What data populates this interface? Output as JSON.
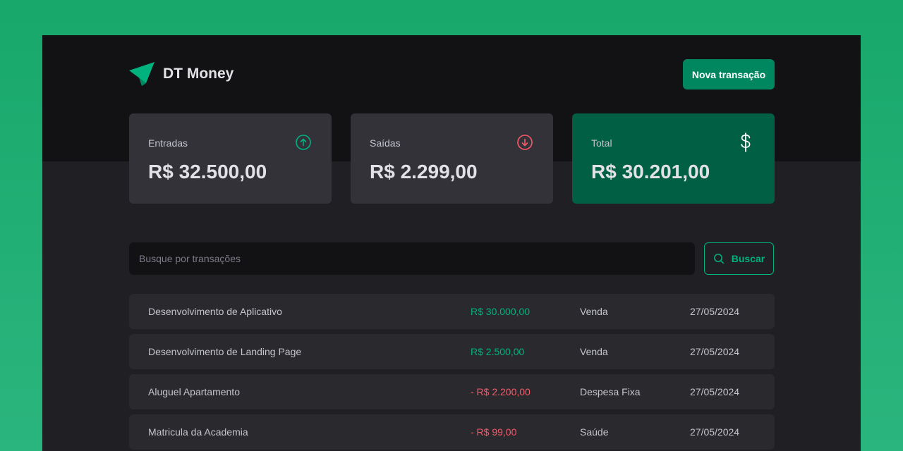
{
  "header": {
    "app_name": "DT Money",
    "new_transaction_label": "Nova transação"
  },
  "summary": {
    "income": {
      "label": "Entradas",
      "value": "R$ 32.500,00",
      "icon": "arrow-circle-up-icon"
    },
    "outcome": {
      "label": "Saídas",
      "value": "R$ 2.299,00",
      "icon": "arrow-circle-down-icon"
    },
    "total": {
      "label": "Total",
      "value": "R$ 30.201,00",
      "icon": "currency-dollar-icon"
    }
  },
  "search": {
    "placeholder": "Busque por transações",
    "value": "",
    "button_label": "Buscar"
  },
  "transactions": [
    {
      "description": "Desenvolvimento de Aplicativo",
      "price": "R$ 30.000,00",
      "type": "income",
      "category": "Venda",
      "date": "27/05/2024"
    },
    {
      "description": "Desenvolvimento de Landing Page",
      "price": "R$ 2.500,00",
      "type": "income",
      "category": "Venda",
      "date": "27/05/2024"
    },
    {
      "description": "Aluguel Apartamento",
      "price": "- R$ 2.200,00",
      "type": "outcome",
      "category": "Despesa Fixa",
      "date": "27/05/2024"
    },
    {
      "description": "Matricula da Academia",
      "price": "- R$ 99,00",
      "type": "outcome",
      "category": "Saúde",
      "date": "27/05/2024"
    }
  ],
  "colors": {
    "brand": "#00875f",
    "brand_light": "#00b37e",
    "danger": "#f75a68",
    "total_card": "#015f43",
    "background": "#202024",
    "header_background": "#121214"
  }
}
